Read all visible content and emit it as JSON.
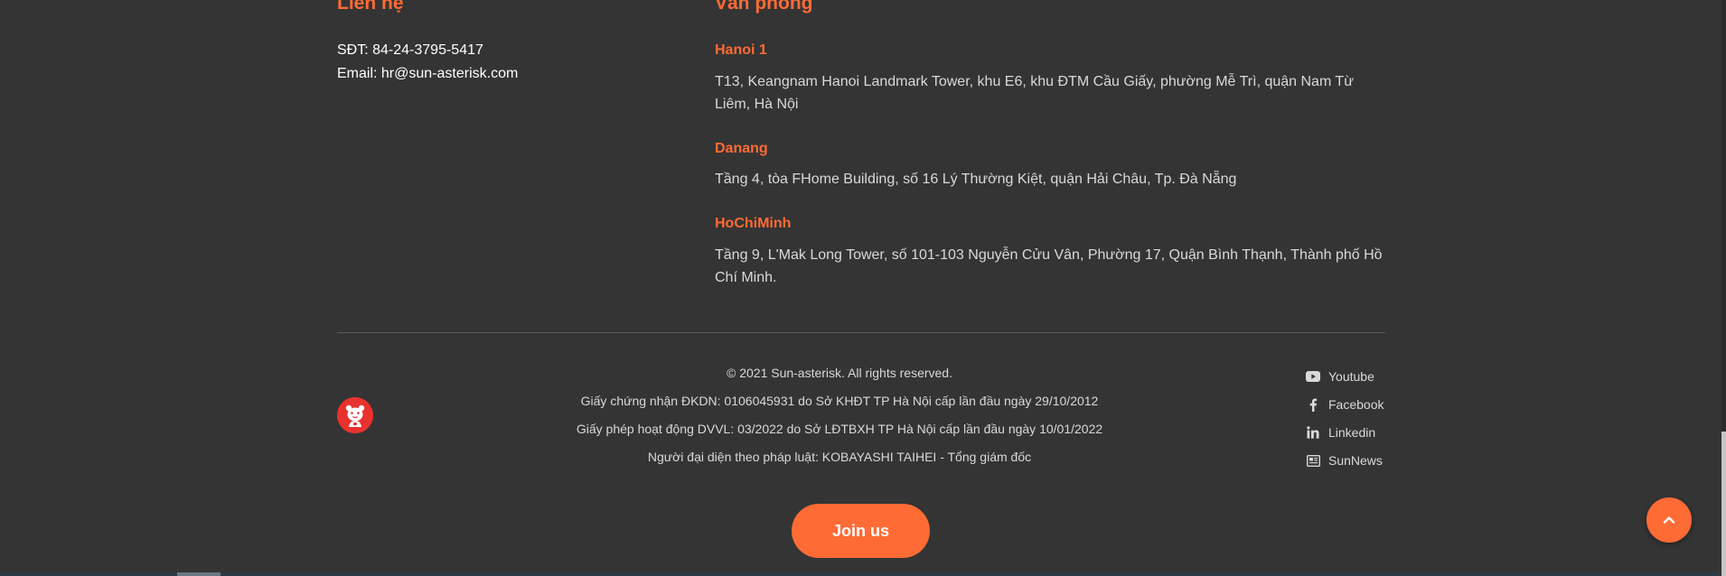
{
  "contact": {
    "heading": "Liên hệ",
    "phone": "SĐT: 84-24-3795-5417",
    "email": "Email: hr@sun-asterisk.com"
  },
  "offices": {
    "heading": "Văn phòng",
    "items": [
      {
        "name": "Hanoi 1",
        "address": "T13, Keangnam Hanoi Landmark Tower, khu E6, khu ĐTM Cầu Giấy, phường Mễ Trì, quận Nam Từ Liêm, Hà Nội"
      },
      {
        "name": "Danang",
        "address": "Tầng 4, tòa FHome Building, số 16 Lý Thường Kiệt, quận Hải Châu, Tp. Đà Nẵng"
      },
      {
        "name": "HoChiMinh",
        "address": "Tầng 9, L'Mak Long Tower, số 101-103 Nguyễn Cửu Vân, Phường 17, Quận Bình Thạnh, Thành phố Hồ Chí Minh."
      }
    ]
  },
  "legal": {
    "copyright": "© 2021 Sun-asterisk. All rights reserved.",
    "registration": "Giấy chứng nhận ĐKDN: 0106045931 do Sở KHĐT TP Hà Nội cấp lần đầu ngày 29/10/2012",
    "license": "Giấy phép hoạt động DVVL: 03/2022 do Sở LĐTBXH TP Hà Nội cấp lần đầu ngày 10/01/2022",
    "representative": "Người đại diện theo pháp luật: KOBAYASHI TAIHEI - Tổng giám đốc"
  },
  "social": [
    {
      "label": "Youtube",
      "icon": "youtube-icon"
    },
    {
      "label": "Facebook",
      "icon": "facebook-icon"
    },
    {
      "label": "Linkedin",
      "icon": "linkedin-icon"
    },
    {
      "label": "SunNews",
      "icon": "newspaper-icon"
    }
  ],
  "cta": {
    "join_label": "Join us"
  },
  "colors": {
    "background": "#343434",
    "accent": "#ff6b35",
    "text": "#d9d9d9",
    "logo": "#e8322e"
  }
}
